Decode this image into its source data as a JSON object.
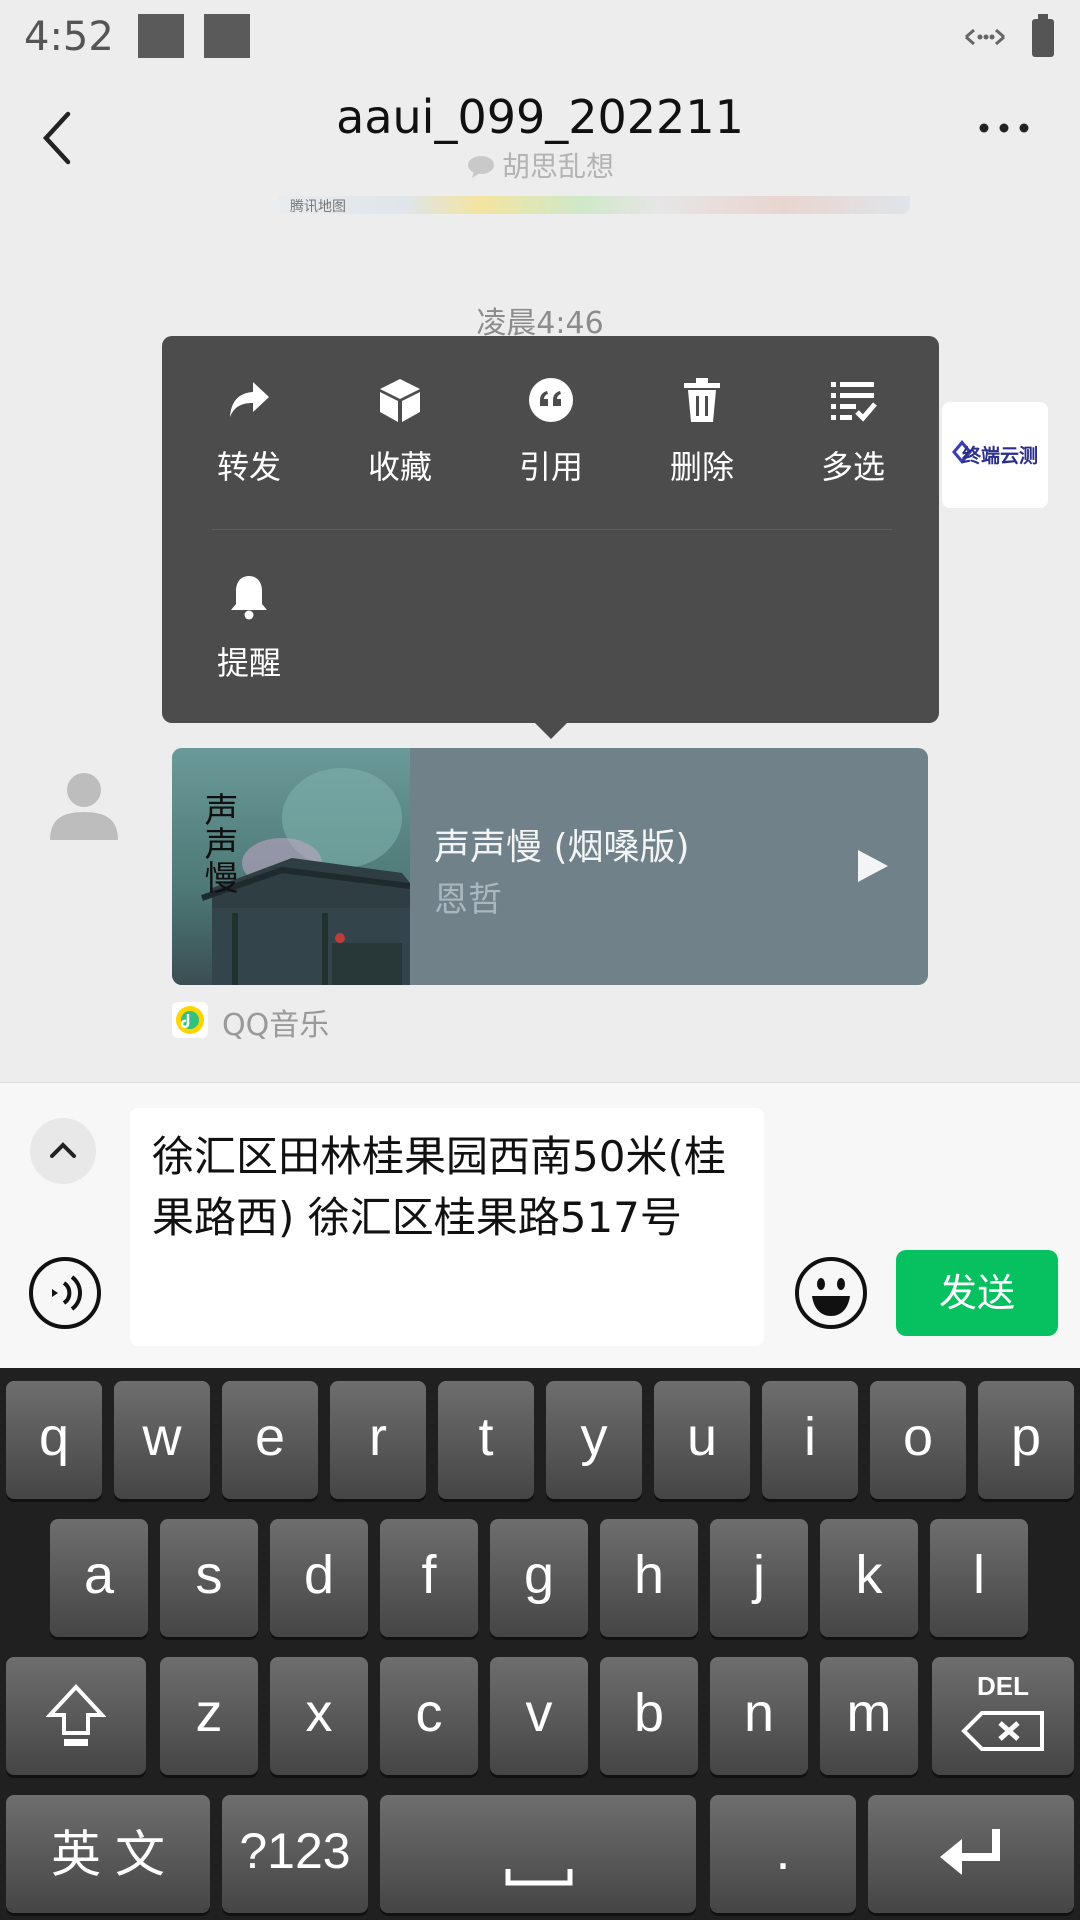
{
  "status_bar": {
    "time": "4:52"
  },
  "header": {
    "title": "aaui_099_202211",
    "subtitle": "胡思乱想"
  },
  "map_snippet": {
    "label": "腾讯地图"
  },
  "chat": {
    "timestamp": "凌晨4:46"
  },
  "context_menu": {
    "items": [
      {
        "label": "转发",
        "icon": "forward-icon"
      },
      {
        "label": "收藏",
        "icon": "favorite-box-icon"
      },
      {
        "label": "引用",
        "icon": "quote-icon"
      },
      {
        "label": "删除",
        "icon": "trash-icon"
      },
      {
        "label": "多选",
        "icon": "multi-select-icon"
      },
      {
        "label": "提醒",
        "icon": "bell-icon"
      }
    ]
  },
  "logo": {
    "text": "终端云测"
  },
  "music_card": {
    "cover_text": "声声慢",
    "song": "声声慢 (烟嗓版)",
    "artist": "恩哲",
    "source": "QQ音乐"
  },
  "input": {
    "text": "徐汇区田林桂果园西南50米(桂果路西) 徐汇区桂果路517号",
    "send_label": "发送"
  },
  "keyboard": {
    "row1": [
      "q",
      "w",
      "e",
      "r",
      "t",
      "y",
      "u",
      "i",
      "o",
      "p"
    ],
    "row2": [
      "a",
      "s",
      "d",
      "f",
      "g",
      "h",
      "j",
      "k",
      "l"
    ],
    "row3": [
      "z",
      "x",
      "c",
      "v",
      "b",
      "n",
      "m"
    ],
    "del_label": "DEL",
    "lang_label": "英 文",
    "sym_label": "?123",
    "period_label": "."
  },
  "colors": {
    "accent": "#07c160",
    "menu_bg": "#4c4c4c",
    "card_bg": "#708189"
  }
}
